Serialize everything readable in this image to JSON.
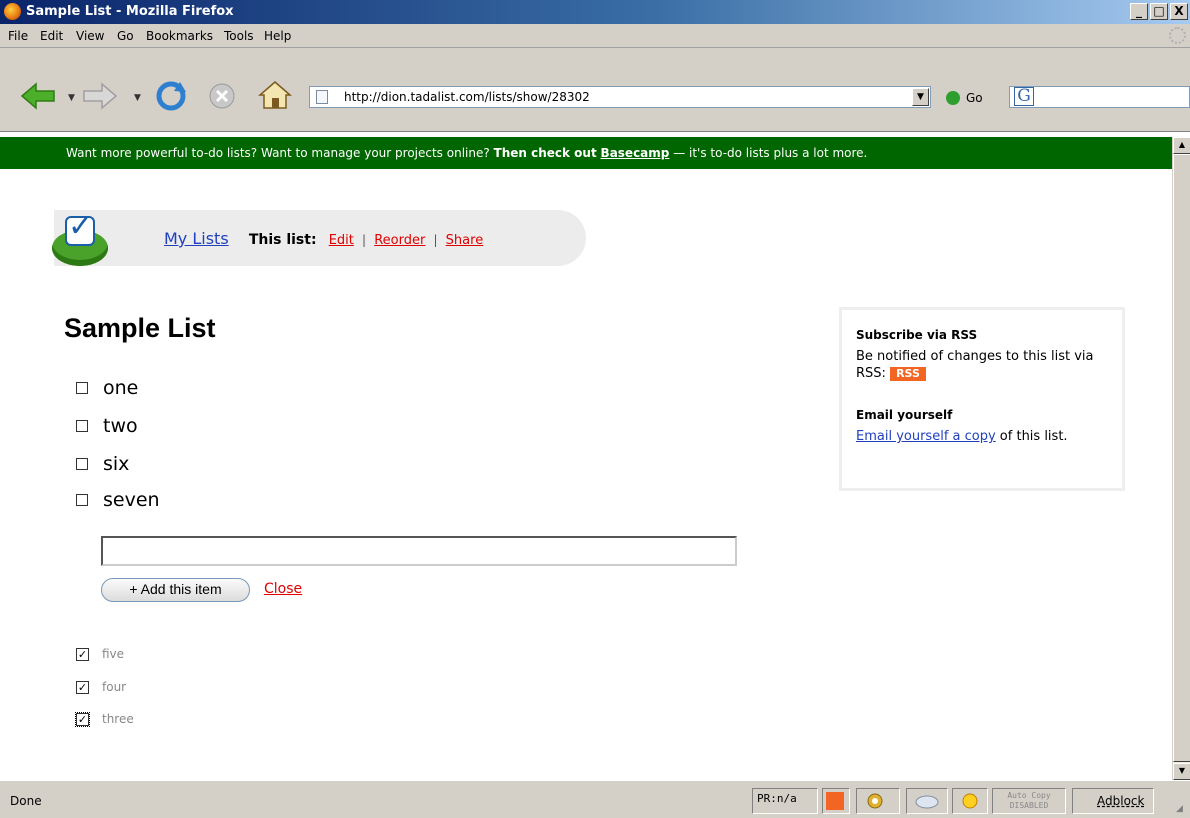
{
  "window": {
    "title": "Sample List - Mozilla Firefox",
    "min": "_",
    "max": "□",
    "close": "X"
  },
  "menu": [
    "File",
    "Edit",
    "View",
    "Go",
    "Bookmarks",
    "Tools",
    "Help"
  ],
  "nav": {
    "url": "http://dion.tadalist.com/lists/show/28302",
    "go_label": "Go",
    "search_logo": "G"
  },
  "promo": {
    "lead": "Want more powerful to-do lists? Want to manage your projects online? ",
    "bold": "Then check out",
    "link": "Basecamp",
    "tail": " — it's to-do lists plus a lot more."
  },
  "header_nav": {
    "my_lists": "My Lists",
    "this_list": "This list:",
    "edit": "Edit",
    "sep": "|",
    "reorder": "Reorder",
    "share": "Share"
  },
  "list": {
    "title": "Sample List",
    "open_items": [
      "one",
      "two",
      "six",
      "seven"
    ],
    "new_item_value": "",
    "add_button": "+ Add this item",
    "close_link": "Close",
    "completed_items": [
      "five",
      "four",
      "three"
    ]
  },
  "sidebar": {
    "rss_heading": "Subscribe via RSS",
    "rss_text": "Be notified of changes to this list via RSS:",
    "rss_badge": "RSS",
    "email_heading": "Email yourself",
    "email_link": "Email yourself a copy",
    "email_tail": " of this list."
  },
  "status": {
    "text": "Done",
    "pagerank": "PR:n/a",
    "auto_copy_line1": "Auto Copy",
    "auto_copy_line2": "DISABLED",
    "adblock": "Adblock"
  },
  "colors": {
    "promo_bg": "#006600",
    "link_red": "#e00000",
    "link_blue": "#2040c0",
    "rss_orange": "#f26522"
  }
}
